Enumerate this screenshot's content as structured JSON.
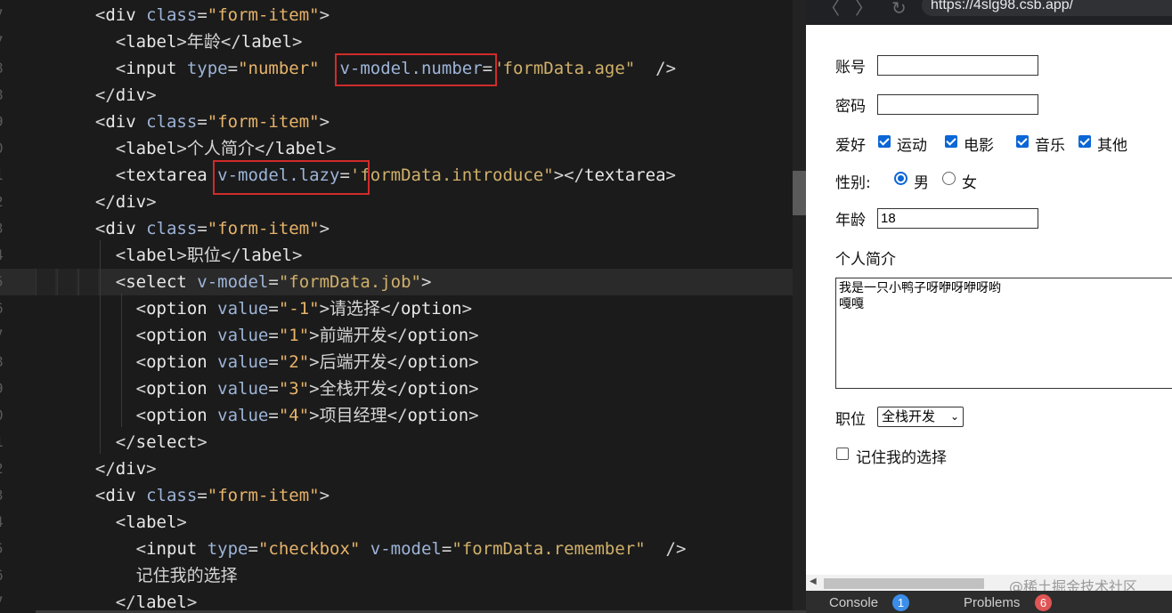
{
  "editor": {
    "gutter": [
      "7",
      "7",
      "8",
      "8",
      "9",
      "0",
      "1",
      "2",
      "3",
      "4",
      "5",
      "6",
      "7",
      "8",
      "9",
      "0",
      "1",
      "2",
      "3",
      "4",
      "5",
      "6",
      "7"
    ],
    "lines": [
      [
        [
          "punc",
          "  <"
        ],
        [
          "tag",
          "div"
        ],
        [
          "punc",
          " "
        ],
        [
          "attr",
          "class"
        ],
        [
          "punc",
          "="
        ],
        [
          "str",
          "\"form-item\""
        ],
        [
          "punc",
          ">"
        ]
      ],
      [
        [
          "punc",
          "    <"
        ],
        [
          "tag",
          "label"
        ],
        [
          "punc",
          ">"
        ],
        [
          "text",
          "年龄"
        ],
        [
          "punc",
          "</"
        ],
        [
          "tag",
          "label"
        ],
        [
          "punc",
          ">"
        ]
      ],
      [
        [
          "punc",
          "    <"
        ],
        [
          "tag",
          "input"
        ],
        [
          "punc",
          " "
        ],
        [
          "attr",
          "type"
        ],
        [
          "punc",
          "="
        ],
        [
          "str",
          "\"number\""
        ],
        [
          "punc",
          "  "
        ],
        [
          "attr",
          "v-model.number"
        ],
        [
          "punc",
          "="
        ],
        [
          "strd",
          "\"formData.age\""
        ],
        [
          "punc",
          "  />"
        ]
      ],
      [
        [
          "punc",
          "  </"
        ],
        [
          "tag",
          "div"
        ],
        [
          "punc",
          ">"
        ]
      ],
      [
        [
          "punc",
          "  <"
        ],
        [
          "tag",
          "div"
        ],
        [
          "punc",
          " "
        ],
        [
          "attr",
          "class"
        ],
        [
          "punc",
          "="
        ],
        [
          "str",
          "\"form-item\""
        ],
        [
          "punc",
          ">"
        ]
      ],
      [
        [
          "punc",
          "    <"
        ],
        [
          "tag",
          "label"
        ],
        [
          "punc",
          ">"
        ],
        [
          "text",
          "个人简介"
        ],
        [
          "punc",
          "</"
        ],
        [
          "tag",
          "label"
        ],
        [
          "punc",
          ">"
        ]
      ],
      [
        [
          "punc",
          "    <"
        ],
        [
          "tag",
          "textarea"
        ],
        [
          "punc",
          " "
        ],
        [
          "attr",
          "v-model.lazy"
        ],
        [
          "punc",
          "="
        ],
        [
          "strd",
          "'formData.introduce\""
        ],
        [
          "punc",
          "></"
        ],
        [
          "tag",
          "textarea"
        ],
        [
          "punc",
          ">"
        ]
      ],
      [
        [
          "punc",
          "  </"
        ],
        [
          "tag",
          "div"
        ],
        [
          "punc",
          ">"
        ]
      ],
      [
        [
          "punc",
          "  <"
        ],
        [
          "tag",
          "div"
        ],
        [
          "punc",
          " "
        ],
        [
          "attr",
          "class"
        ],
        [
          "punc",
          "="
        ],
        [
          "str",
          "\"form-item\""
        ],
        [
          "punc",
          ">"
        ]
      ],
      [
        [
          "punc",
          "    <"
        ],
        [
          "tag",
          "label"
        ],
        [
          "punc",
          ">"
        ],
        [
          "text",
          "职位"
        ],
        [
          "punc",
          "</"
        ],
        [
          "tag",
          "label"
        ],
        [
          "punc",
          ">"
        ]
      ],
      [
        [
          "punc",
          "    <"
        ],
        [
          "tag",
          "select"
        ],
        [
          "punc",
          " "
        ],
        [
          "attr",
          "v-model"
        ],
        [
          "punc",
          "="
        ],
        [
          "strd",
          "\"formData.job\""
        ],
        [
          "punc",
          ">"
        ]
      ],
      [
        [
          "punc",
          "      <"
        ],
        [
          "tag",
          "option"
        ],
        [
          "punc",
          " "
        ],
        [
          "attr",
          "value"
        ],
        [
          "punc",
          "="
        ],
        [
          "str",
          "\"-1\""
        ],
        [
          "punc",
          ">"
        ],
        [
          "text",
          "请选择"
        ],
        [
          "punc",
          "</"
        ],
        [
          "tag",
          "option"
        ],
        [
          "punc",
          ">"
        ]
      ],
      [
        [
          "punc",
          "      <"
        ],
        [
          "tag",
          "option"
        ],
        [
          "punc",
          " "
        ],
        [
          "attr",
          "value"
        ],
        [
          "punc",
          "="
        ],
        [
          "str",
          "\"1\""
        ],
        [
          "punc",
          ">"
        ],
        [
          "text",
          "前端开发"
        ],
        [
          "punc",
          "</"
        ],
        [
          "tag",
          "option"
        ],
        [
          "punc",
          ">"
        ]
      ],
      [
        [
          "punc",
          "      <"
        ],
        [
          "tag",
          "option"
        ],
        [
          "punc",
          " "
        ],
        [
          "attr",
          "value"
        ],
        [
          "punc",
          "="
        ],
        [
          "str",
          "\"2\""
        ],
        [
          "punc",
          ">"
        ],
        [
          "text",
          "后端开发"
        ],
        [
          "punc",
          "</"
        ],
        [
          "tag",
          "option"
        ],
        [
          "punc",
          ">"
        ]
      ],
      [
        [
          "punc",
          "      <"
        ],
        [
          "tag",
          "option"
        ],
        [
          "punc",
          " "
        ],
        [
          "attr",
          "value"
        ],
        [
          "punc",
          "="
        ],
        [
          "str",
          "\"3\""
        ],
        [
          "punc",
          ">"
        ],
        [
          "text",
          "全栈开发"
        ],
        [
          "punc",
          "</"
        ],
        [
          "tag",
          "option"
        ],
        [
          "punc",
          ">"
        ]
      ],
      [
        [
          "punc",
          "      <"
        ],
        [
          "tag",
          "option"
        ],
        [
          "punc",
          " "
        ],
        [
          "attr",
          "value"
        ],
        [
          "punc",
          "="
        ],
        [
          "str",
          "\"4\""
        ],
        [
          "punc",
          ">"
        ],
        [
          "text",
          "项目经理"
        ],
        [
          "punc",
          "</"
        ],
        [
          "tag",
          "option"
        ],
        [
          "punc",
          ">"
        ]
      ],
      [
        [
          "punc",
          "    </"
        ],
        [
          "tag",
          "select"
        ],
        [
          "punc",
          ">"
        ]
      ],
      [
        [
          "punc",
          "  </"
        ],
        [
          "tag",
          "div"
        ],
        [
          "punc",
          ">"
        ]
      ],
      [
        [
          "punc",
          "  <"
        ],
        [
          "tag",
          "div"
        ],
        [
          "punc",
          " "
        ],
        [
          "attr",
          "class"
        ],
        [
          "punc",
          "="
        ],
        [
          "str",
          "\"form-item\""
        ],
        [
          "punc",
          ">"
        ]
      ],
      [
        [
          "punc",
          "    <"
        ],
        [
          "tag",
          "label"
        ],
        [
          "punc",
          ">"
        ]
      ],
      [
        [
          "punc",
          "      <"
        ],
        [
          "tag",
          "input"
        ],
        [
          "punc",
          " "
        ],
        [
          "attr",
          "type"
        ],
        [
          "punc",
          "="
        ],
        [
          "str",
          "\"checkbox\""
        ],
        [
          "punc",
          " "
        ],
        [
          "attr",
          "v-model"
        ],
        [
          "punc",
          "="
        ],
        [
          "strd",
          "\"formData.remember\""
        ],
        [
          "punc",
          "  />"
        ]
      ],
      [
        [
          "text",
          "      记住我的选择"
        ]
      ],
      [
        [
          "punc",
          "    </"
        ],
        [
          "tag",
          "label"
        ],
        [
          "punc",
          ">"
        ]
      ]
    ],
    "active_line": 10
  },
  "browser": {
    "url": "https://4slg98.csb.app/",
    "back_glyph": "〈",
    "forward_glyph": "〉",
    "reload_glyph": "↻",
    "form": {
      "account_label": "账号",
      "account_value": "",
      "password_label": "密码",
      "password_value": "",
      "hobby_label": "爱好",
      "hobbies": [
        {
          "label": "运动",
          "checked": true
        },
        {
          "label": "电影",
          "checked": true
        },
        {
          "label": "音乐",
          "checked": true
        },
        {
          "label": "其他",
          "checked": true
        }
      ],
      "gender_label": "性别:",
      "genders": [
        {
          "label": "男",
          "selected": true
        },
        {
          "label": "女",
          "selected": false
        }
      ],
      "age_label": "年龄",
      "age_value": "18",
      "intro_label": "个人简介",
      "intro_value": "我是一只小鸭子呀咿呀咿呀哟\n嘎嘎",
      "job_label": "职位",
      "job_value": "全栈开发",
      "remember_label": "记住我的选择",
      "remember_checked": false
    },
    "watermark": "@稀土掘金技术社区",
    "scroll_left_glyph": "◀",
    "bottom_tabs": [
      {
        "label": "Console",
        "count": "1",
        "color": "#3b8eea"
      },
      {
        "label": "Problems",
        "count": "6",
        "color": "#e05555"
      }
    ]
  },
  "colors": {
    "highlight_box": "#d12b2b",
    "accent_blue": "#0b66d6"
  }
}
